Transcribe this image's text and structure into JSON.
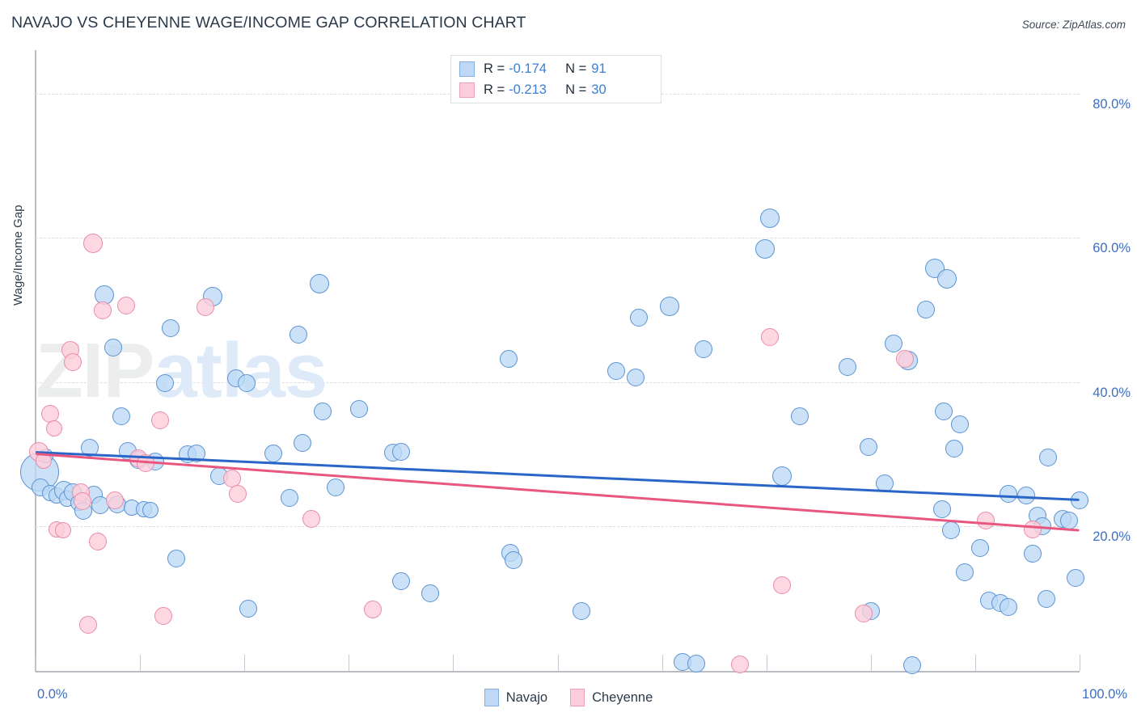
{
  "header": {
    "title": "NAVAJO VS CHEYENNE WAGE/INCOME GAP CORRELATION CHART",
    "source": "Source: ZipAtlas.com"
  },
  "watermark": {
    "part1": "ZIP",
    "part2": "atlas"
  },
  "stats": {
    "rows": [
      {
        "series": "Navajo",
        "r_label": "R =",
        "r_value": "-0.174",
        "n_label": "N =",
        "n_value": "91",
        "color": "#bfd8f5"
      },
      {
        "series": "Cheyenne",
        "r_label": "R =",
        "r_value": "-0.213",
        "n_label": "N =",
        "n_value": "30",
        "color": "#fbccdb"
      }
    ]
  },
  "legend": {
    "items": [
      {
        "label": "Navajo",
        "color": "#bfd8f5"
      },
      {
        "label": "Cheyenne",
        "color": "#fbccdb"
      }
    ]
  },
  "chart_data": {
    "type": "scatter",
    "title": "NAVAJO VS CHEYENNE WAGE/INCOME GAP CORRELATION CHART",
    "xlabel": "",
    "ylabel": "Wage/Income Gap",
    "xlim": [
      0,
      100
    ],
    "ylim": [
      0,
      86
    ],
    "x_tick_labels": [
      "0.0%",
      "100.0%"
    ],
    "y_tick_labels": [
      "20.0%",
      "40.0%",
      "60.0%",
      "80.0%"
    ],
    "y_ticks": [
      20,
      40,
      60,
      80
    ],
    "grid": "horizontal-dashed",
    "legend_position": "bottom-center",
    "colors": {
      "navajo_fill": "#bcd9f5",
      "navajo_stroke": "#5b93d4",
      "cheyenne_fill": "#fccedb",
      "cheyenne_stroke": "#e98ba9",
      "navajo_line": "#2a66c8",
      "cheyenne_line": "#e8577f",
      "axis_label": "#3b6fc4"
    },
    "series": [
      {
        "name": "Navajo",
        "r": -0.174,
        "n": 91,
        "trendline": {
          "x0": 0,
          "y0": 30.3,
          "x1": 100,
          "y1": 23.7
        },
        "points": [
          [
            0.4,
            27.6,
            24
          ],
          [
            0.5,
            25.4,
            11
          ],
          [
            1.0,
            29.8,
            9
          ],
          [
            1.4,
            24.6,
            10
          ],
          [
            2.0,
            24.3,
            10
          ],
          [
            2.7,
            25.0,
            12
          ],
          [
            3.0,
            23.9,
            10
          ],
          [
            3.6,
            24.8,
            11
          ],
          [
            4.1,
            23.3,
            10
          ],
          [
            4.6,
            22.2,
            11
          ],
          [
            5.2,
            30.9,
            11
          ],
          [
            5.6,
            24.4,
            11
          ],
          [
            6.2,
            22.9,
            11
          ],
          [
            6.6,
            52.1,
            12
          ],
          [
            7.4,
            44.8,
            11
          ],
          [
            7.8,
            23.1,
            11
          ],
          [
            8.2,
            35.3,
            11
          ],
          [
            8.8,
            30.5,
            11
          ],
          [
            9.2,
            22.6,
            10
          ],
          [
            9.8,
            29.2,
            11
          ],
          [
            10.4,
            22.4,
            10
          ],
          [
            11.0,
            22.3,
            10
          ],
          [
            11.5,
            29.0,
            11
          ],
          [
            12.4,
            39.9,
            11
          ],
          [
            12.9,
            47.5,
            11
          ],
          [
            13.5,
            15.6,
            11
          ],
          [
            14.6,
            30.0,
            11
          ],
          [
            15.4,
            30.1,
            11
          ],
          [
            17.0,
            51.9,
            12
          ],
          [
            17.6,
            27.0,
            11
          ],
          [
            19.2,
            40.5,
            11
          ],
          [
            20.2,
            39.9,
            11
          ],
          [
            20.4,
            8.6,
            11
          ],
          [
            22.8,
            30.1,
            11
          ],
          [
            24.3,
            24.0,
            11
          ],
          [
            25.2,
            46.6,
            11
          ],
          [
            25.6,
            31.6,
            11
          ],
          [
            27.2,
            53.6,
            12
          ],
          [
            27.5,
            35.9,
            11
          ],
          [
            28.7,
            25.4,
            11
          ],
          [
            31.0,
            36.3,
            11
          ],
          [
            35.0,
            12.4,
            11
          ],
          [
            37.8,
            10.8,
            11
          ],
          [
            34.2,
            30.2,
            11
          ],
          [
            35.0,
            30.4,
            11
          ],
          [
            45.3,
            43.2,
            11
          ],
          [
            45.5,
            16.4,
            11
          ],
          [
            45.8,
            15.3,
            11
          ],
          [
            52.3,
            8.3,
            11
          ],
          [
            55.6,
            41.6,
            11
          ],
          [
            57.5,
            40.6,
            11
          ],
          [
            57.8,
            48.9,
            11
          ],
          [
            60.7,
            50.5,
            12
          ],
          [
            62.0,
            1.2,
            11
          ],
          [
            64.0,
            44.6,
            11
          ],
          [
            70.3,
            62.7,
            12
          ],
          [
            69.9,
            58.4,
            12
          ],
          [
            71.5,
            27.0,
            12
          ],
          [
            73.2,
            35.3,
            11
          ],
          [
            77.8,
            42.1,
            11
          ],
          [
            79.8,
            31.0,
            11
          ],
          [
            80.0,
            8.3,
            11
          ],
          [
            81.3,
            26.0,
            11
          ],
          [
            82.2,
            45.4,
            11
          ],
          [
            83.6,
            43.0,
            12
          ],
          [
            84.0,
            0.8,
            11
          ],
          [
            86.1,
            55.8,
            12
          ],
          [
            87.3,
            54.3,
            12
          ],
          [
            85.3,
            50.0,
            11
          ],
          [
            87.0,
            36.0,
            11
          ],
          [
            88.5,
            34.2,
            11
          ],
          [
            88.0,
            30.8,
            11
          ],
          [
            86.8,
            22.4,
            11
          ],
          [
            87.7,
            19.5,
            11
          ],
          [
            89.0,
            13.7,
            11
          ],
          [
            90.5,
            17.0,
            11
          ],
          [
            91.3,
            9.7,
            11
          ],
          [
            92.4,
            9.4,
            11
          ],
          [
            93.2,
            8.8,
            11
          ],
          [
            93.2,
            24.5,
            11
          ],
          [
            94.9,
            24.3,
            11
          ],
          [
            95.5,
            16.2,
            11
          ],
          [
            96.0,
            21.5,
            11
          ],
          [
            96.4,
            20.1,
            11
          ],
          [
            96.8,
            10.0,
            11
          ],
          [
            97.0,
            29.6,
            11
          ],
          [
            98.4,
            21.0,
            11
          ],
          [
            99.6,
            12.9,
            11
          ],
          [
            100.0,
            23.6,
            11
          ],
          [
            99.0,
            20.8,
            11
          ],
          [
            63.3,
            1.0,
            11
          ]
        ]
      },
      {
        "name": "Cheyenne",
        "r": -0.213,
        "n": 30,
        "trendline": {
          "x0": 0,
          "y0": 30.0,
          "x1": 100,
          "y1": 19.4
        },
        "points": [
          [
            0.3,
            30.3,
            12
          ],
          [
            0.8,
            29.1,
            10
          ],
          [
            1.4,
            35.6,
            11
          ],
          [
            1.8,
            33.6,
            10
          ],
          [
            2.0,
            19.6,
            10
          ],
          [
            2.6,
            19.5,
            10
          ],
          [
            3.3,
            44.5,
            11
          ],
          [
            3.6,
            42.8,
            11
          ],
          [
            4.3,
            24.8,
            11
          ],
          [
            4.5,
            23.5,
            11
          ],
          [
            5.0,
            6.4,
            11
          ],
          [
            5.5,
            59.2,
            12
          ],
          [
            6.0,
            17.9,
            11
          ],
          [
            6.4,
            49.9,
            11
          ],
          [
            7.6,
            23.6,
            11
          ],
          [
            8.7,
            50.6,
            11
          ],
          [
            9.8,
            29.5,
            11
          ],
          [
            10.5,
            28.8,
            11
          ],
          [
            11.9,
            34.7,
            11
          ],
          [
            12.2,
            7.6,
            11
          ],
          [
            16.3,
            50.4,
            11
          ],
          [
            18.8,
            26.6,
            11
          ],
          [
            19.4,
            24.5,
            11
          ],
          [
            26.4,
            21.0,
            11
          ],
          [
            32.3,
            8.5,
            11
          ],
          [
            70.3,
            46.3,
            11
          ],
          [
            71.5,
            11.9,
            11
          ],
          [
            79.3,
            7.9,
            11
          ],
          [
            83.3,
            43.2,
            11
          ],
          [
            67.5,
            0.9,
            11
          ],
          [
            91.0,
            20.8,
            11
          ],
          [
            95.5,
            19.6,
            11
          ]
        ]
      }
    ]
  }
}
